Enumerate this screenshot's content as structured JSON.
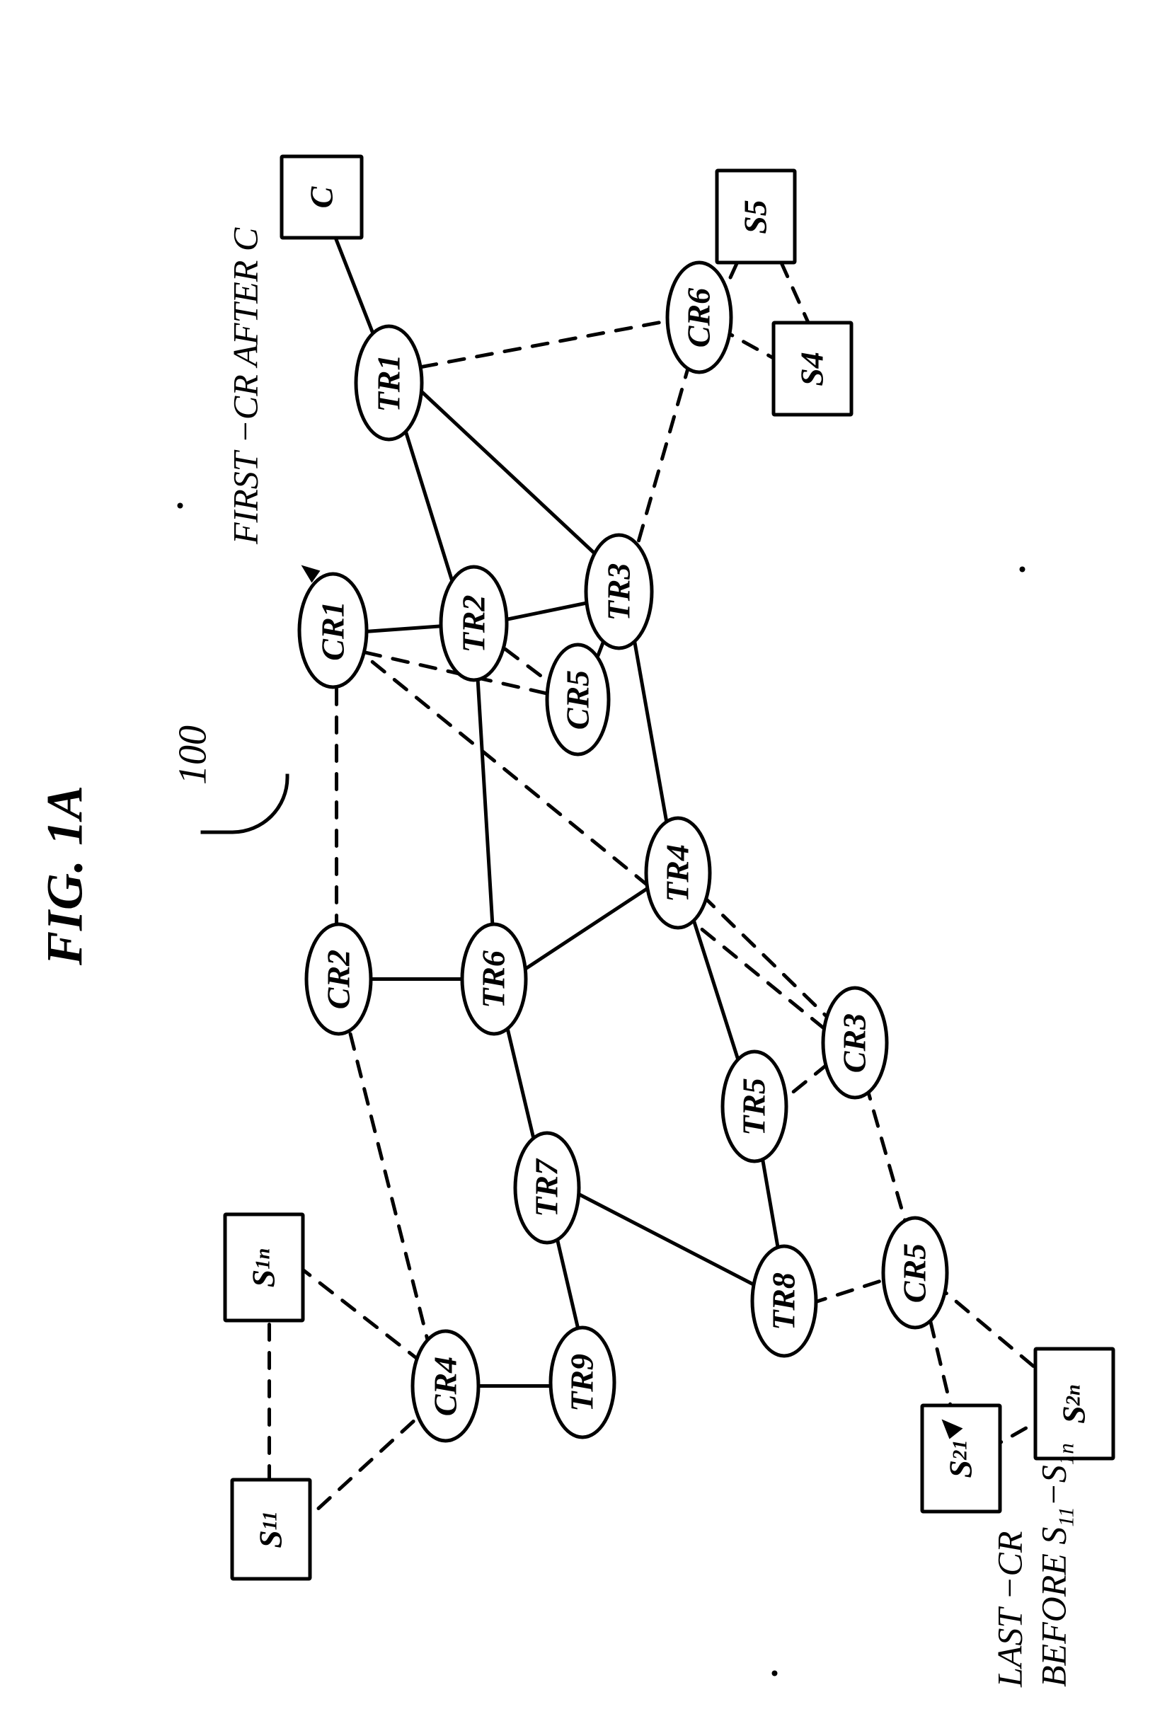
{
  "figure": {
    "title": "FIG. 1A",
    "reference": "100",
    "annotations": {
      "first_cr": "FIRST −CR AFTER C",
      "last_cr_line1": "LAST −CR",
      "last_cr_line2_prefix": "BEFORE S",
      "last_cr_line2_sub1": "11",
      "last_cr_line2_mid": "−S",
      "last_cr_line2_sub2": "1n"
    }
  },
  "nodes": {
    "cr1": "CR1",
    "cr2": "CR2",
    "cr3": "CR3",
    "cr4": "CR4",
    "cr5a": "CR5",
    "cr5b": "CR5",
    "cr6": "CR6",
    "tr1": "TR1",
    "tr2": "TR2",
    "tr3": "TR3",
    "tr4": "TR4",
    "tr5": "TR5",
    "tr6": "TR6",
    "tr7": "TR7",
    "tr8": "TR8",
    "tr9": "TR9",
    "c": "C",
    "s11_prefix": "S",
    "s11_sub": "11",
    "s1n_prefix": "S",
    "s1n_sub": "1n",
    "s21_prefix": "S",
    "s21_sub": "21",
    "s2n_prefix": "S",
    "s2n_sub": "2n",
    "s4": "S4",
    "s5": "S5"
  }
}
